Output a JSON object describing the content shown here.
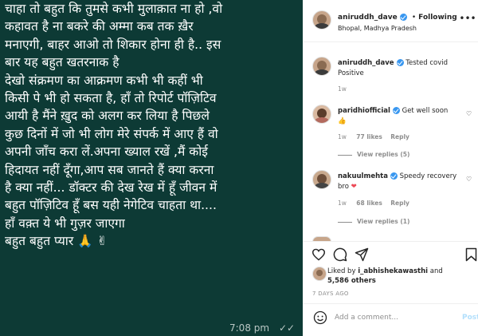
{
  "post_image": {
    "message_lines": [
      "चाहा तो बहुत कि तुमसे कभी मुलाक़ात ना हो ,वो",
      "कहावत है ना बकरे की अम्मा कब तक ख़ैर",
      "मनाएगी, बाहर आओ तो शिकार होना ही है.. इस",
      "बार यह बहुत खतरनाक है",
      "देखो संक्रमण का आक्रमण कभी भी कहीं भी",
      "किसी पे भी हो सकता है, हाँ तो रिपोर्ट पॉज़िटिव",
      "आयी है मैंने ख़ुद को अलग कर लिया है पिछले",
      "कुछ दिनों में जो भी लोग मेरे संपर्क में आए हैं वो",
      "अपनी जाँच करा लें.अपना ख्याल रखें ,मैं कोई",
      "हिदायत नहीं दूँगा,आप सब जानते हैं क्या करना",
      "है क्या नहीं... डॉक्टर की देख रेख में हूँ जीवन में",
      "बहुत पॉज़िटिव हूँ बस यही नेगेटिव चाहता था....",
      "हाँ वक़्त ये भी गुज़र जाएगा",
      "बहुत बहुत प्यार 🙏 ✌"
    ],
    "time": "7:08 pm",
    "ticks": "✓✓",
    "bg_color": "#0d3a35"
  },
  "header": {
    "username": "aniruddh_dave",
    "separator": "•",
    "follow_label": "Following",
    "location": "Bhopal, Madhya Pradesh"
  },
  "caption": {
    "username": "aniruddh_dave",
    "text": "Tested covid Positive",
    "age": "1w"
  },
  "comments": [
    {
      "username": "paridhiofficial",
      "text": "Get well soon",
      "emoji": "👍",
      "age": "1w",
      "likes": "77 likes",
      "reply": "Reply",
      "view_replies": "View replies (5)"
    },
    {
      "username": "nakuulmehta",
      "text": "Speedy recovery bro",
      "emoji": "❤",
      "age": "1w",
      "likes": "68 likes",
      "reply": "Reply",
      "view_replies": "View replies (1)"
    }
  ],
  "actions": {
    "liked_by_prefix": "Liked by",
    "liked_by_user": "i_abhishekawasthi",
    "liked_by_suffix": "and",
    "others": "5,586 others",
    "date": "7 DAYS AGO"
  },
  "comment_box": {
    "placeholder": "Add a comment...",
    "post_label": "Post"
  },
  "icons": {
    "heart": "heart-icon",
    "comment": "comment-icon",
    "share": "share-icon",
    "save": "bookmark-icon",
    "emoji": "smiley-icon"
  }
}
